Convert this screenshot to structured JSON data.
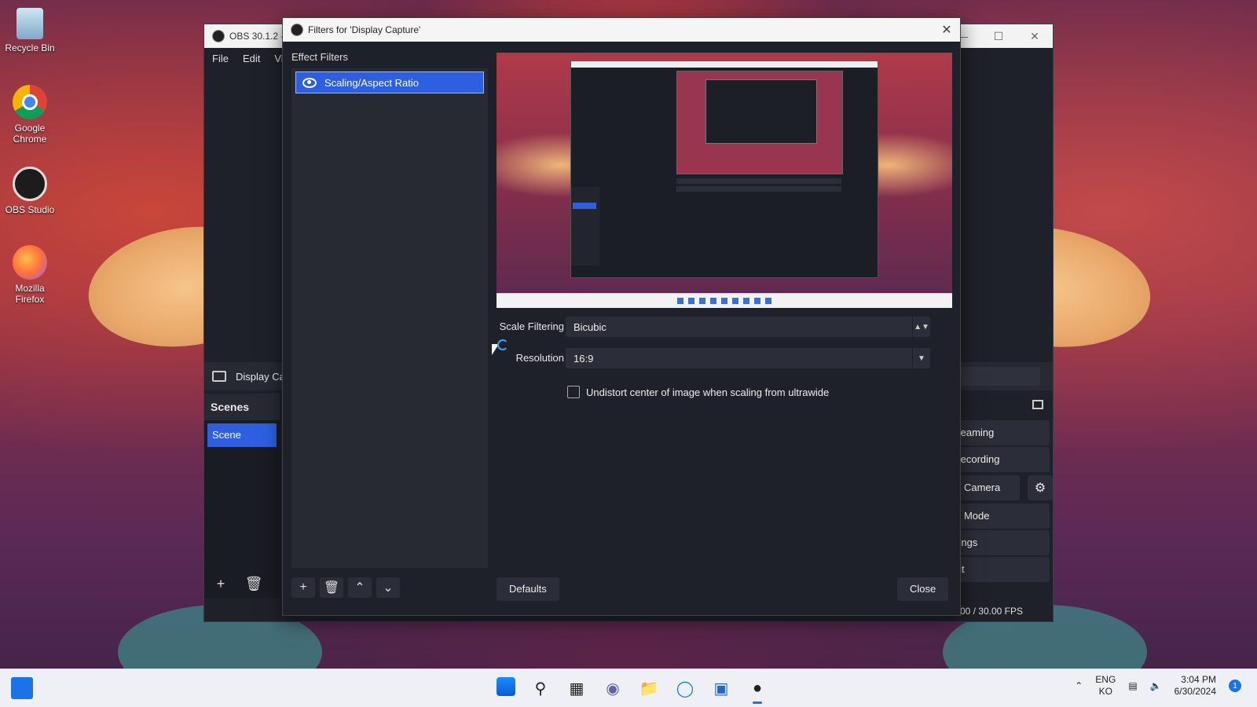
{
  "desktop": {
    "icons": [
      {
        "label": "Recycle Bin"
      },
      {
        "label": "Google Chrome"
      },
      {
        "label": "OBS Studio"
      },
      {
        "label": "Mozilla Firefox"
      }
    ]
  },
  "obs_main": {
    "title": "OBS 30.1.2 -",
    "menu": [
      "File",
      "Edit",
      "Vie"
    ],
    "source_label": "Display Ca",
    "scenes_header": "Scenes",
    "scene_item": "Scene",
    "controls": {
      "streaming": "Streaming",
      "recording": "t Recording",
      "virtual_camera": "ual Camera",
      "studio_mode": "dio Mode",
      "settings": "ettings",
      "exit": "Exit"
    },
    "status_fps": "00 / 30.00 FPS"
  },
  "dialog": {
    "title": "Filters for 'Display Capture'",
    "effect_filters_label": "Effect Filters",
    "filters": [
      {
        "name": "Scaling/Aspect Ratio"
      }
    ],
    "scale_filtering": {
      "label": "Scale Filtering",
      "value": "Bicubic"
    },
    "resolution": {
      "label": "Resolution",
      "value": "16:9"
    },
    "undistort": {
      "label": "Undistort center of image when scaling from ultrawide",
      "checked": false
    },
    "defaults_button": "Defaults",
    "close_button": "Close"
  },
  "taskbar": {
    "lang_top": "ENG",
    "lang_bottom": "KO",
    "time": "3:04 PM",
    "date": "6/30/2024",
    "notification_count": "1"
  },
  "colors": {
    "accent": "#2d5fe0",
    "panel": "#1f212a",
    "control": "#2b2e38"
  }
}
